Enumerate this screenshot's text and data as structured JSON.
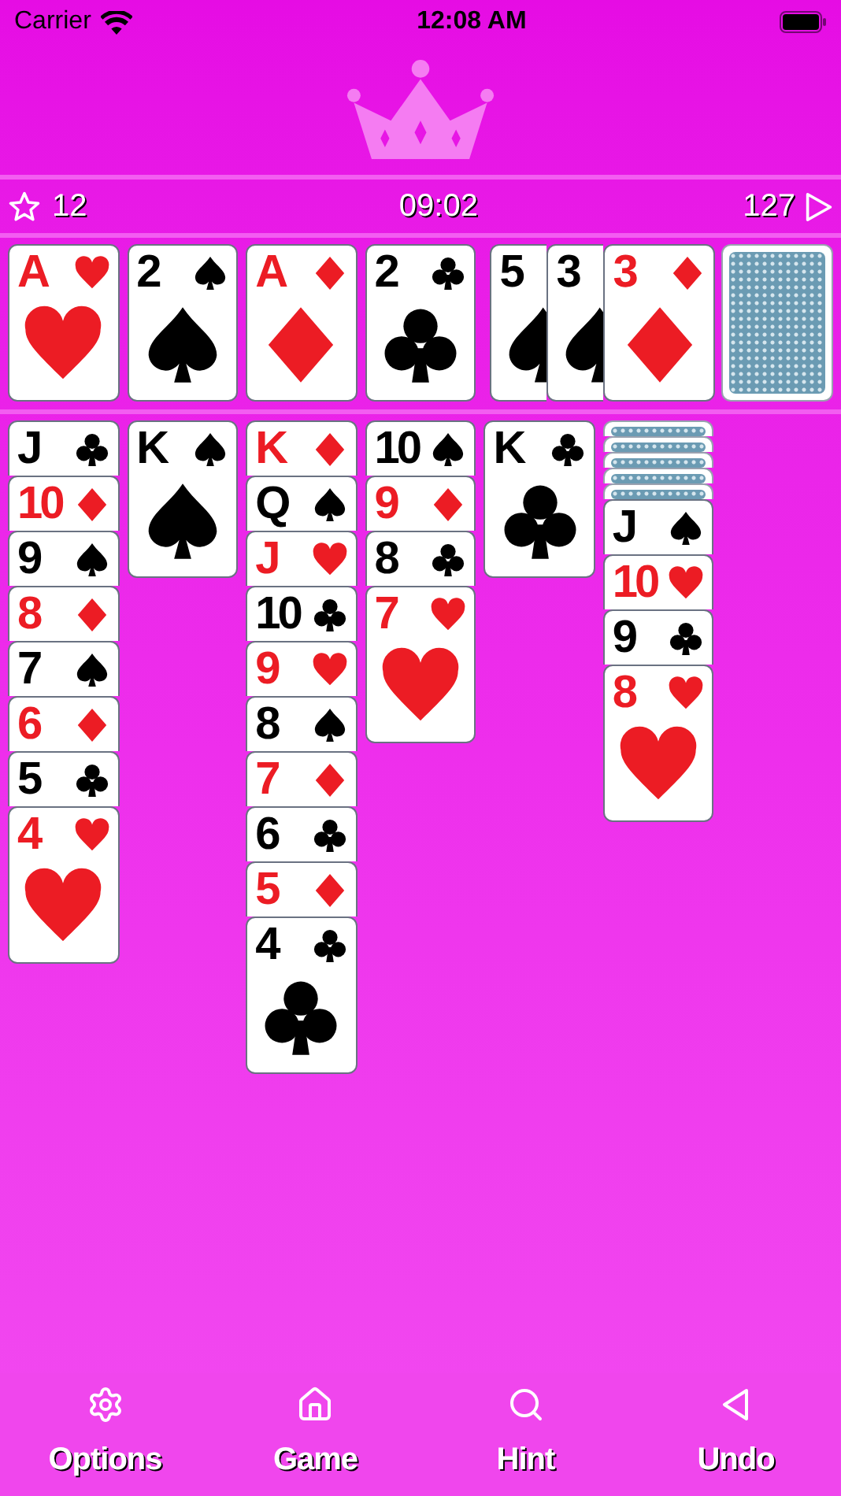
{
  "status_bar": {
    "carrier": "Carrier",
    "time": "12:08 AM"
  },
  "stats": {
    "score": "12",
    "timer": "09:02",
    "moves": "127"
  },
  "foundations": [
    {
      "rank": "A",
      "kind": "hearts"
    },
    {
      "rank": "2",
      "kind": "spades"
    },
    {
      "rank": "A",
      "kind": "diamonds"
    },
    {
      "rank": "2",
      "kind": "clubs"
    }
  ],
  "waste": [
    {
      "rank": "5",
      "kind": "spades"
    },
    {
      "rank": "3",
      "kind": "spades"
    },
    {
      "rank": "3",
      "kind": "diamonds"
    }
  ],
  "tableau": [
    [
      {
        "face_up": true,
        "rank": "J",
        "kind": "clubs"
      },
      {
        "face_up": true,
        "rank": "10",
        "kind": "diamonds"
      },
      {
        "face_up": true,
        "rank": "9",
        "kind": "spades"
      },
      {
        "face_up": true,
        "rank": "8",
        "kind": "diamonds"
      },
      {
        "face_up": true,
        "rank": "7",
        "kind": "spades"
      },
      {
        "face_up": true,
        "rank": "6",
        "kind": "diamonds"
      },
      {
        "face_up": true,
        "rank": "5",
        "kind": "clubs"
      },
      {
        "face_up": true,
        "rank": "4",
        "kind": "hearts"
      }
    ],
    [
      {
        "face_up": true,
        "rank": "K",
        "kind": "spades"
      }
    ],
    [
      {
        "face_up": true,
        "rank": "K",
        "kind": "diamonds"
      },
      {
        "face_up": true,
        "rank": "Q",
        "kind": "spades"
      },
      {
        "face_up": true,
        "rank": "J",
        "kind": "hearts"
      },
      {
        "face_up": true,
        "rank": "10",
        "kind": "clubs"
      },
      {
        "face_up": true,
        "rank": "9",
        "kind": "hearts"
      },
      {
        "face_up": true,
        "rank": "8",
        "kind": "spades"
      },
      {
        "face_up": true,
        "rank": "7",
        "kind": "diamonds"
      },
      {
        "face_up": true,
        "rank": "6",
        "kind": "clubs"
      },
      {
        "face_up": true,
        "rank": "5",
        "kind": "diamonds"
      },
      {
        "face_up": true,
        "rank": "4",
        "kind": "clubs"
      }
    ],
    [
      {
        "face_up": true,
        "rank": "10",
        "kind": "spades"
      },
      {
        "face_up": true,
        "rank": "9",
        "kind": "diamonds"
      },
      {
        "face_up": true,
        "rank": "8",
        "kind": "clubs"
      },
      {
        "face_up": true,
        "rank": "7",
        "kind": "hearts"
      }
    ],
    [
      {
        "face_up": true,
        "rank": "K",
        "kind": "clubs"
      }
    ],
    [
      {
        "face_up": false
      },
      {
        "face_up": false
      },
      {
        "face_up": false
      },
      {
        "face_up": false
      },
      {
        "face_up": false
      },
      {
        "face_up": true,
        "rank": "J",
        "kind": "spades"
      },
      {
        "face_up": true,
        "rank": "10",
        "kind": "hearts"
      },
      {
        "face_up": true,
        "rank": "9",
        "kind": "clubs"
      },
      {
        "face_up": true,
        "rank": "8",
        "kind": "hearts"
      }
    ]
  ],
  "toolbar": [
    {
      "kind": "gear",
      "label": "Options"
    },
    {
      "kind": "home",
      "label": "Game"
    },
    {
      "kind": "search",
      "label": "Hint"
    },
    {
      "kind": "back",
      "label": "Undo"
    }
  ]
}
